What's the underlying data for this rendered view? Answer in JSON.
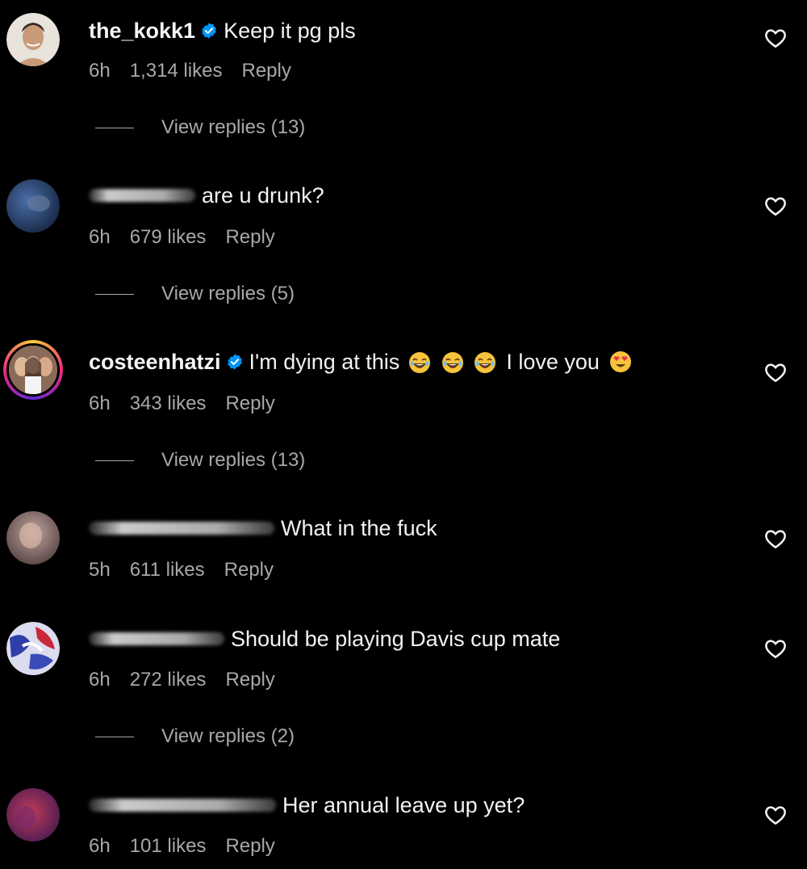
{
  "colors": {
    "background": "#000000",
    "text_primary": "#f5f5f5",
    "text_secondary": "#a8a8a8",
    "verified_badge": "#0095f6",
    "story_ring": "#ee2a7b"
  },
  "comments": [
    {
      "username": "the_kokk1",
      "verified": true,
      "text": "Keep it pg pls",
      "time": "6h",
      "likes": "1,314 likes",
      "reply_label": "Reply",
      "view_replies": "View replies (13)",
      "avatar_icon": "profile-photo-icon"
    },
    {
      "username": "",
      "username_blurred": true,
      "text": "are u drunk?",
      "time": "6h",
      "likes": "679 likes",
      "reply_label": "Reply",
      "view_replies": "View replies (5)",
      "avatar_icon": "profile-photo-icon"
    },
    {
      "username": "costeenhatzi",
      "verified": true,
      "has_story": true,
      "text": "I'm dying at this",
      "emojis_1": [
        "laughing-emoji",
        "laughing-emoji",
        "laughing-emoji"
      ],
      "text_2": "I love you",
      "emojis_2": [
        "heart-eyes-emoji"
      ],
      "time": "6h",
      "likes": "343 likes",
      "reply_label": "Reply",
      "view_replies": "View replies (13)",
      "avatar_icon": "profile-photo-icon"
    },
    {
      "username": "",
      "username_blurred": true,
      "text": "What in the fuck",
      "time": "5h",
      "likes": "611 likes",
      "reply_label": "Reply",
      "avatar_icon": "profile-photo-icon"
    },
    {
      "username": "",
      "username_blurred": true,
      "text": "Should be playing Davis cup mate",
      "time": "6h",
      "likes": "272 likes",
      "reply_label": "Reply",
      "view_replies": "View replies (2)",
      "avatar_icon": "profile-photo-icon"
    },
    {
      "username": "",
      "username_blurred": true,
      "text": "Her annual leave up yet?",
      "time": "6h",
      "likes": "101 likes",
      "reply_label": "Reply",
      "avatar_icon": "profile-photo-icon"
    }
  ],
  "icons": {
    "like": "heart-outline-icon",
    "verified": "verified-badge-icon"
  }
}
